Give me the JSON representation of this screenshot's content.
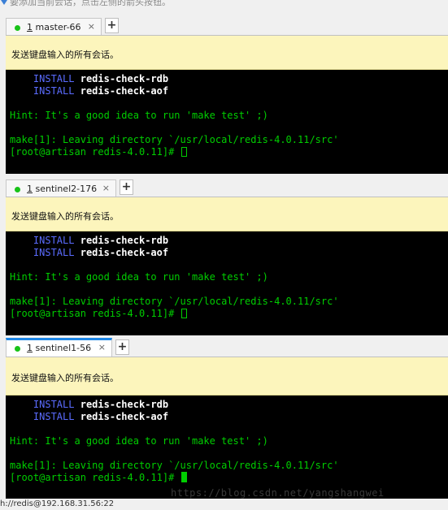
{
  "top_hint": "要添加当前会话，点击左侧的箭头按钮。",
  "panes": [
    {
      "tab": {
        "num": "1",
        "name": "master-66",
        "close": "×",
        "active": false
      },
      "banner": "发送键盘输入的所有会话。",
      "lines": {
        "install1_kw": "INSTALL",
        "install1_val": "redis-check-rdb",
        "install2_kw": "INSTALL",
        "install2_val": "redis-check-aof",
        "hint": "Hint: It's a good idea to run 'make test' ;)",
        "make": "make[1]: Leaving directory `/usr/local/redis-4.0.11/src'",
        "prompt": "[root@artisan redis-4.0.11]# "
      }
    },
    {
      "tab": {
        "num": "1",
        "name": "sentinel2-176",
        "close": "×",
        "active": false
      },
      "banner": "发送键盘输入的所有会话。",
      "lines": {
        "install1_kw": "INSTALL",
        "install1_val": "redis-check-rdb",
        "install2_kw": "INSTALL",
        "install2_val": "redis-check-aof",
        "hint": "Hint: It's a good idea to run 'make test' ;)",
        "make": "make[1]: Leaving directory `/usr/local/redis-4.0.11/src'",
        "prompt": "[root@artisan redis-4.0.11]# "
      }
    },
    {
      "tab": {
        "num": "1",
        "name": "sentinel1-56",
        "close": "×",
        "active": true
      },
      "banner": "发送键盘输入的所有会话。",
      "lines": {
        "install1_kw": "INSTALL",
        "install1_val": "redis-check-rdb",
        "install2_kw": "INSTALL",
        "install2_val": "redis-check-aof",
        "hint": "Hint: It's a good idea to run 'make test' ;)",
        "make": "make[1]: Leaving directory `/usr/local/redis-4.0.11/src'",
        "prompt": "[root@artisan redis-4.0.11]# "
      }
    }
  ],
  "add_tab_label": "+",
  "watermark": "https://blog.csdn.net/yangshangwei",
  "status_text": "h://redis@192.168.31.56:22",
  "colors": {
    "accent": "#1c86e6",
    "status_dot": "#18c318",
    "banner_bg": "#fcf5bc",
    "terminal_text": "#00ce00",
    "install_kw": "#5b6cff"
  },
  "icons": [
    "arrow-icon",
    "connected-dot-icon",
    "close-icon",
    "add-tab-icon"
  ]
}
